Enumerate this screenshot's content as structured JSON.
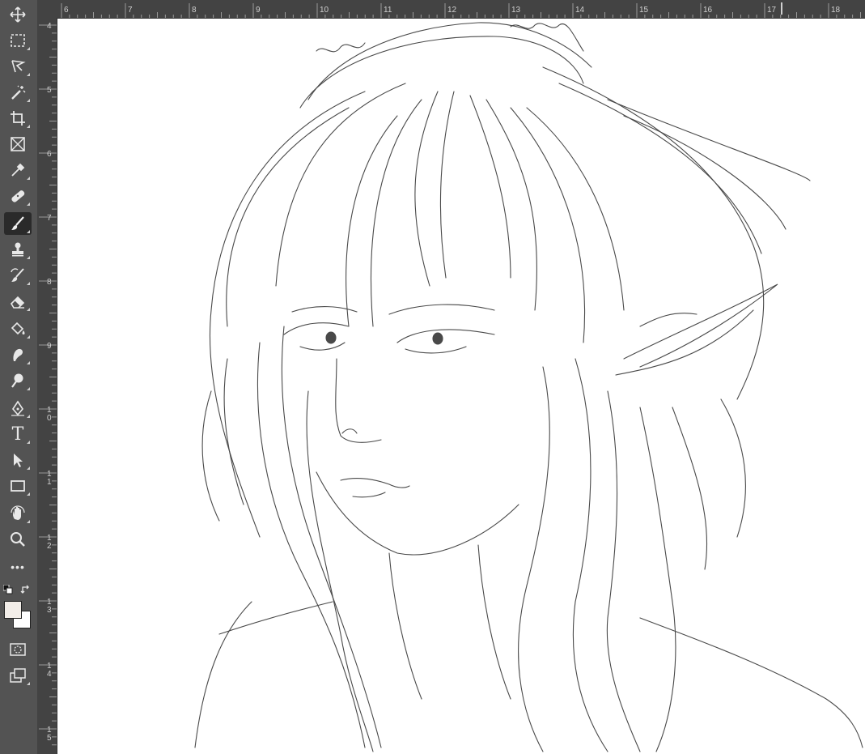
{
  "tools": [
    {
      "name": "move-tool",
      "icon": "move-icon"
    },
    {
      "name": "rectangular-marquee-tool",
      "icon": "marquee-icon"
    },
    {
      "name": "lasso-tool",
      "icon": "lasso-icon"
    },
    {
      "name": "magic-wand-tool",
      "icon": "magic-wand-icon"
    },
    {
      "name": "crop-tool",
      "icon": "crop-icon"
    },
    {
      "name": "frame-tool",
      "icon": "frame-icon"
    },
    {
      "name": "eyedropper-tool",
      "icon": "eyedropper-icon"
    },
    {
      "name": "healing-brush-tool",
      "icon": "bandage-icon"
    },
    {
      "name": "brush-tool",
      "icon": "brush-icon",
      "active": true
    },
    {
      "name": "clone-stamp-tool",
      "icon": "stamp-icon"
    },
    {
      "name": "history-brush-tool",
      "icon": "history-brush-icon"
    },
    {
      "name": "eraser-tool",
      "icon": "eraser-icon"
    },
    {
      "name": "paint-bucket-tool",
      "icon": "bucket-icon"
    },
    {
      "name": "smudge-tool",
      "icon": "smudge-icon"
    },
    {
      "name": "dodge-tool",
      "icon": "dodge-icon"
    },
    {
      "name": "pen-tool",
      "icon": "pen-icon"
    },
    {
      "name": "type-tool",
      "icon": "type-icon",
      "glyph": "T"
    },
    {
      "name": "path-selection-tool",
      "icon": "arrow-icon"
    },
    {
      "name": "rectangle-tool",
      "icon": "rectangle-icon"
    },
    {
      "name": "rotate-view-tool",
      "icon": "hand-rotate-icon"
    },
    {
      "name": "zoom-tool",
      "icon": "zoom-icon"
    },
    {
      "name": "edit-toolbar",
      "icon": "more-icon",
      "glyph": "•••"
    }
  ],
  "colors": {
    "foreground": "#f3eee9",
    "background": "#ffffff"
  },
  "rulers": {
    "horizontal": [
      "6",
      "7",
      "8",
      "9",
      "10",
      "11",
      "12",
      "13",
      "14",
      "15",
      "16",
      "17",
      "18"
    ],
    "vertical": [
      "4",
      "5",
      "6",
      "7",
      "8",
      "9",
      "1\n0",
      "1\n1",
      "1\n2",
      "1\n3",
      "1\n4",
      "1\n5"
    ]
  }
}
